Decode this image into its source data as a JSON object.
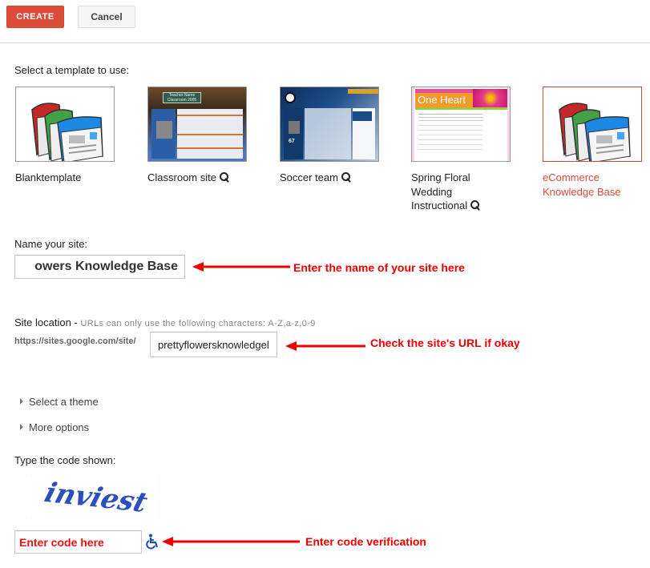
{
  "toolbar": {
    "create_label": "CREATE",
    "cancel_label": "Cancel"
  },
  "templates": {
    "heading": "Select a template to use:",
    "items": [
      {
        "name": "Blanktemplate",
        "preview": false,
        "selected": false,
        "icon": "sites-pages-icon"
      },
      {
        "name": "Classroom site",
        "preview": true,
        "selected": false,
        "icon": "classroom-thumbnail"
      },
      {
        "name": "Soccer team",
        "preview": true,
        "selected": false,
        "icon": "soccer-thumbnail"
      },
      {
        "name": "Spring Floral Wedding Instructional",
        "preview": true,
        "selected": false,
        "icon": "floral-thumbnail"
      },
      {
        "name": "eCommerce Knowledge Base",
        "preview": false,
        "selected": true,
        "icon": "sites-pages-icon"
      }
    ],
    "thumb_text": {
      "classroom_banner_1": "Teacher Name",
      "classroom_banner_2": "Classroom 2005",
      "floral_banner": "One Heart",
      "soccer_score": "67"
    }
  },
  "site_name": {
    "label": "Name your site:",
    "value": "owers Knowledge Base",
    "annotation": "Enter the name of your site here"
  },
  "site_location": {
    "label": "Site location - ",
    "hint": "URLs can only use the following characters: A-Z,a-z,0-9",
    "prefix": "https://sites.google.com/site/",
    "value": "prettyflowersknowledgel",
    "annotation": "Check the site's URL if okay"
  },
  "expanders": [
    {
      "label": "Select a theme",
      "icon": "triangle-right-icon"
    },
    {
      "label": "More options",
      "icon": "triangle-right-icon"
    }
  ],
  "captcha": {
    "label": "Type the code shown:",
    "word": "inviest",
    "input_value": "Enter code here",
    "annotation": "Enter code verification",
    "audio_icon": "wheelchair-accessibility-icon"
  },
  "colors": {
    "primary_button": "#dd4b39",
    "selected_template": "#dd4b39",
    "annotation_red": "#ee0000",
    "captcha_blue": "#2b4fbf"
  }
}
